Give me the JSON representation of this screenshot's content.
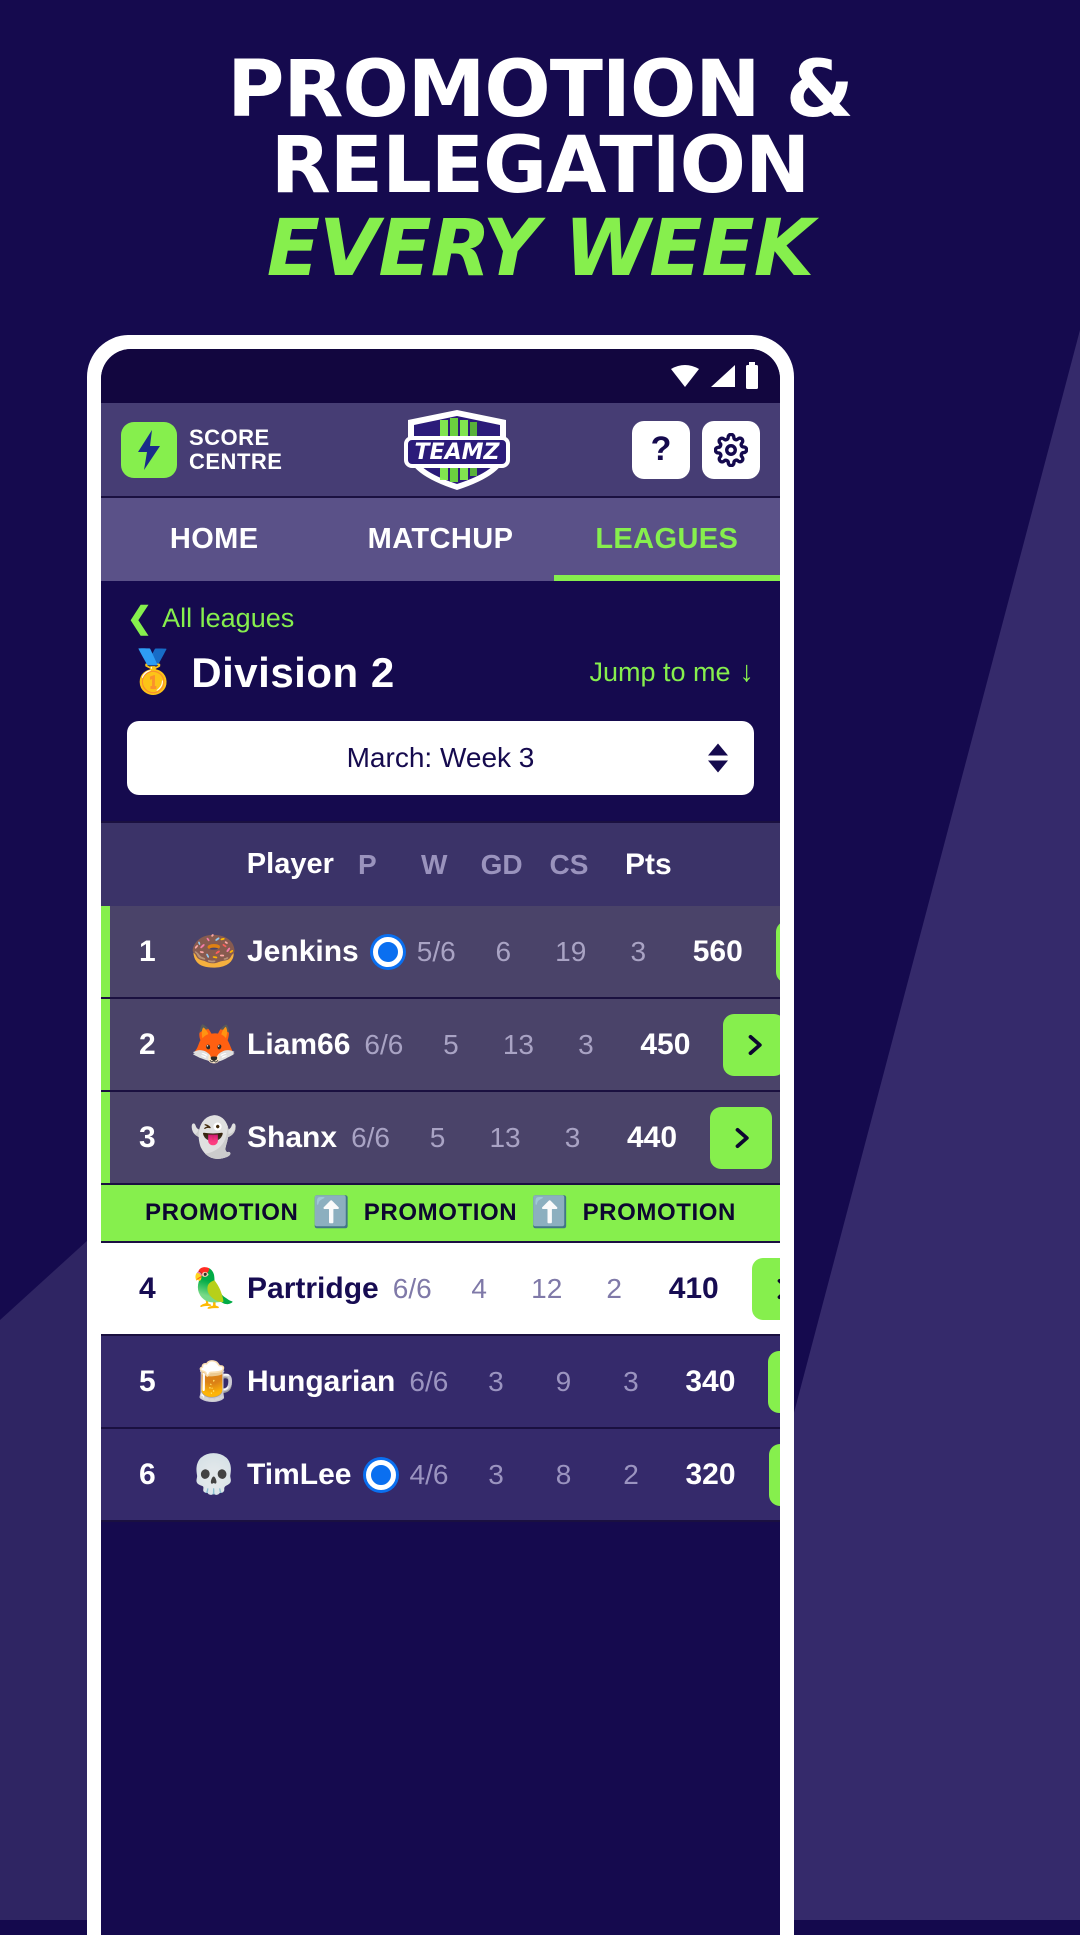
{
  "headline": {
    "line1": "PROMOTION &",
    "line2": "RELEGATION",
    "line3": "EVERY WEEK"
  },
  "colors": {
    "accent_green": "#86ef4d",
    "bg_navy": "#150a4e",
    "appbar_purple": "#463d74",
    "tabbar_purple": "#5a5188",
    "row_dark": "#4a4369",
    "row_purple": "#352a6b",
    "me_blue": "#0a6ff0"
  },
  "statusbar": {
    "wifi_icon": "wifi-icon",
    "signal_icon": "signal-icon",
    "battery_icon": "battery-icon"
  },
  "appbar": {
    "brand_icon": "lightning-bolt-icon",
    "brand_line1": "SCORE",
    "brand_line2": "CENTRE",
    "logo_text": "TEAMZ",
    "logo_icon": "teamz-shield-logo",
    "help_label": "?",
    "settings_icon": "gear-icon"
  },
  "tabs": [
    {
      "label": "HOME",
      "active": false
    },
    {
      "label": "MATCHUP",
      "active": false
    },
    {
      "label": "LEAGUES",
      "active": true
    }
  ],
  "league": {
    "back_label": "All leagues",
    "back_icon": "chevron-left-icon",
    "medal_emoji": "🥇",
    "title": "Division 2",
    "jump_label": "Jump to me",
    "jump_icon": "arrow-down-icon",
    "week_value": "March: Week 3",
    "week_spinner_icon": "spinner-up-down-icon"
  },
  "table": {
    "columns": [
      "Player",
      "P",
      "W",
      "GD",
      "CS",
      "Pts"
    ],
    "rows": [
      {
        "rank": "1",
        "emoji": "🍩",
        "name": "Jenkins",
        "is_me": true,
        "p": "5/6",
        "w": "6",
        "gd": "19",
        "cs": "3",
        "pts": "560",
        "style": "dark",
        "promotion": true
      },
      {
        "rank": "2",
        "emoji": "🦊",
        "name": "Liam66",
        "is_me": false,
        "p": "6/6",
        "w": "5",
        "gd": "13",
        "cs": "3",
        "pts": "450",
        "style": "dark",
        "promotion": true
      },
      {
        "rank": "3",
        "emoji": "👻",
        "name": "Shanx",
        "is_me": false,
        "p": "6/6",
        "w": "5",
        "gd": "13",
        "cs": "3",
        "pts": "440",
        "style": "dark",
        "promotion": true
      },
      {
        "rank": "4",
        "emoji": "🦜",
        "name": "Partridge",
        "is_me": false,
        "p": "6/6",
        "w": "4",
        "gd": "12",
        "cs": "2",
        "pts": "410",
        "style": "white",
        "promotion": false
      },
      {
        "rank": "5",
        "emoji": "🍺",
        "name": "Hungarian",
        "is_me": false,
        "p": "6/6",
        "w": "3",
        "gd": "9",
        "cs": "3",
        "pts": "340",
        "style": "purple",
        "promotion": false
      },
      {
        "rank": "6",
        "emoji": "💀",
        "name": "TimLee",
        "is_me": true,
        "p": "4/6",
        "w": "3",
        "gd": "8",
        "cs": "2",
        "pts": "320",
        "style": "purple",
        "promotion": false
      }
    ],
    "promotion_band": {
      "label": "PROMOTION",
      "arrow_emoji": "⬆️",
      "repeats": 3
    },
    "row_action_icon": "chevron-right-icon"
  }
}
